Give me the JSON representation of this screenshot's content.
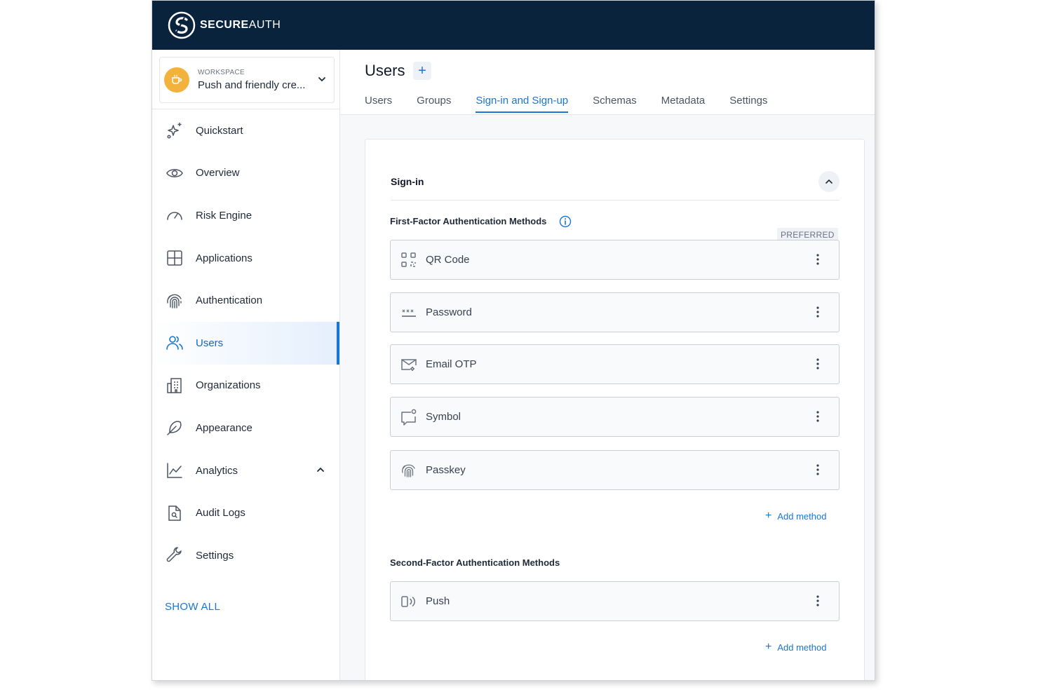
{
  "brand": {
    "bold": "SECURE",
    "light": "AUTH"
  },
  "workspace": {
    "label": "WORKSPACE",
    "name": "Push and friendly cre..."
  },
  "sidebar": {
    "items": [
      {
        "label": "Quickstart",
        "icon": "sparkle-icon"
      },
      {
        "label": "Overview",
        "icon": "eye-icon"
      },
      {
        "label": "Risk Engine",
        "icon": "gauge-icon"
      },
      {
        "label": "Applications",
        "icon": "grid-icon"
      },
      {
        "label": "Authentication",
        "icon": "fingerprint-icon"
      },
      {
        "label": "Users",
        "icon": "users-icon",
        "active": true
      },
      {
        "label": "Organizations",
        "icon": "building-icon"
      },
      {
        "label": "Appearance",
        "icon": "feather-icon"
      },
      {
        "label": "Analytics",
        "icon": "chart-line-icon"
      },
      {
        "label": "Audit Logs",
        "icon": "document-search-icon"
      },
      {
        "label": "Settings",
        "icon": "wrench-icon"
      }
    ],
    "show_all": "SHOW ALL"
  },
  "page": {
    "title": "Users",
    "add_symbol": "+",
    "tabs": [
      "Users",
      "Groups",
      "Sign-in and Sign-up",
      "Schemas",
      "Metadata",
      "Settings"
    ],
    "active_tab": "Sign-in and Sign-up"
  },
  "signin": {
    "title": "Sign-in",
    "first_factor": {
      "title": "First-Factor Authentication Methods",
      "preferred_badge": "PREFERRED",
      "methods": [
        "QR Code",
        "Password",
        "Email OTP",
        "Symbol",
        "Passkey"
      ],
      "add_label": "Add method"
    },
    "second_factor": {
      "title": "Second-Factor Authentication Methods",
      "methods": [
        "Push"
      ],
      "add_label": "Add method"
    }
  },
  "colors": {
    "topbar": "#0a233d",
    "accent": "#1976d2",
    "workspace_avatar": "#f3b23b"
  }
}
